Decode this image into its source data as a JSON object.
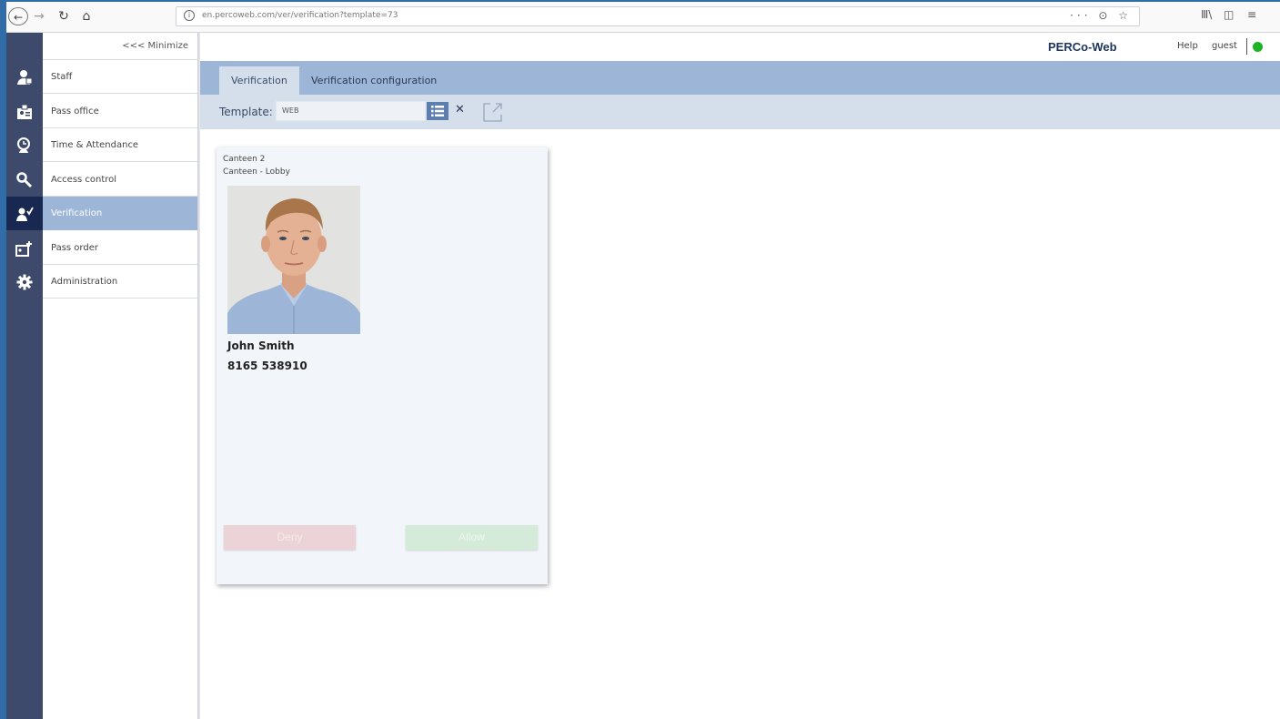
{
  "browser": {
    "url": "en.percoweb.com/ver/verification?template=73",
    "back_icon": "arrow-left-icon",
    "forward_icon": "arrow-right-icon",
    "reload_icon": "reload-icon",
    "home_icon": "home-icon",
    "page_actions": "··· ⊙ ☆",
    "library_icon": "library-icon",
    "sidebar_icon": "sidebar-icon",
    "menu_icon": "hamburger-icon"
  },
  "menu": {
    "minimize_label": "<<< Minimize",
    "items": [
      {
        "label": "Staff",
        "icon": "staff-icon"
      },
      {
        "label": "Pass office",
        "icon": "pass-office-icon"
      },
      {
        "label": "Time & Attendance",
        "icon": "time-attendance-icon"
      },
      {
        "label": "Access control",
        "icon": "access-control-icon"
      },
      {
        "label": "Verification",
        "icon": "verification-icon",
        "active": true
      },
      {
        "label": "Pass order",
        "icon": "pass-order-icon"
      },
      {
        "label": "Administration",
        "icon": "gear-icon"
      }
    ]
  },
  "header": {
    "brand": "PERCo-Web",
    "help": "Help",
    "user": "guest",
    "status_color": "#1cb324"
  },
  "tabs": [
    {
      "label": "Verification",
      "active": true
    },
    {
      "label": "Verification configuration",
      "active": false
    }
  ],
  "template_bar": {
    "label": "Template:",
    "value": "WEB"
  },
  "card": {
    "access_point": "Canteen 2",
    "zone": "Canteen - Lobby",
    "name": "John Smith",
    "number": "8165 538910",
    "deny_label": "Deny",
    "allow_label": "Allow"
  },
  "colors": {
    "icon_bar": "#3d4a6b",
    "active_menu": "#9db6d8",
    "tabs_bar": "#9db6d8",
    "template_bar": "#d4dfeb"
  }
}
